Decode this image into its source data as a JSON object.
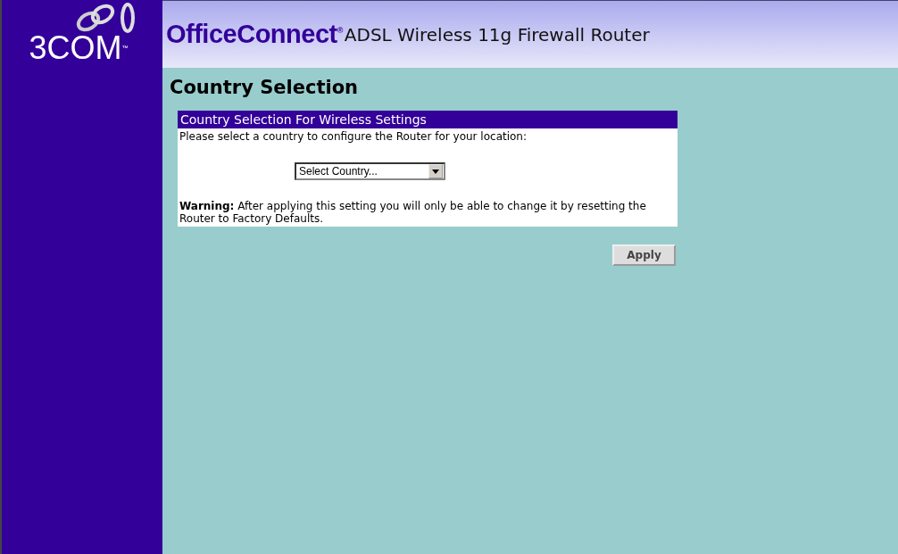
{
  "sidebar": {
    "logo": "3COM$^{™}$"
  },
  "header": {
    "brand": "OfficeConnect$^{®}$",
    "product": "ADSL Wireless 11g Firewall Router"
  },
  "page_title": "Country Selection",
  "panel": {
    "title": "Country Selection For Wireless Settings",
    "prompt": "Please select a country to configure the Router for your location:",
    "country_select": {
      "value": "Select Country..."
    },
    "warning": "**Warning:** After applying this setting you will only be able to change it by resetting the Router to Factory Defaults."
  },
  "buttons": [
    "Apply"
  ]
}
